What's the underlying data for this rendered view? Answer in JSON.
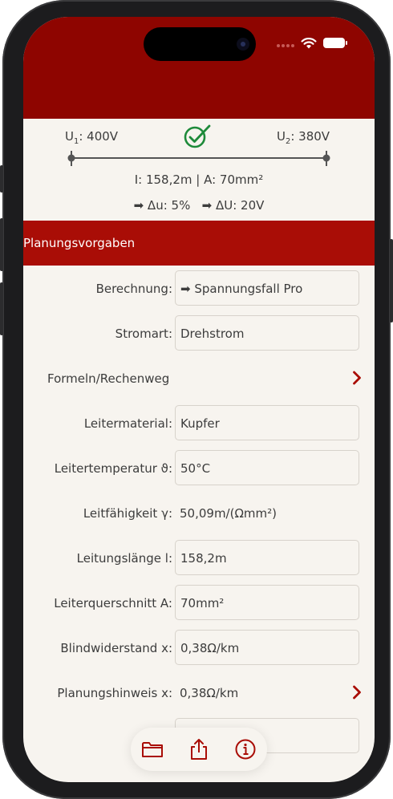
{
  "status_bar": {
    "icons": [
      "signal-dots-icon",
      "wifi-icon",
      "battery-icon"
    ]
  },
  "summary": {
    "u1_label": "U",
    "u1_sub": "1",
    "u1_value": ": 400V",
    "u2_label": "U",
    "u2_sub": "2",
    "u2_value": ": 380V",
    "status_icon": "check-circle-icon",
    "cable_line": "I: 158,2m  |  A: 70mm²",
    "drop_line_1": "➡ Δu: 5%",
    "drop_line_2": "➡ ΔU: 20V"
  },
  "section": {
    "title": "Planungsvorgaben"
  },
  "rows": [
    {
      "label": "Berechnung:",
      "value": "➡ Spannungsfall Pro"
    },
    {
      "label": "Stromart:",
      "value": "Drehstrom"
    },
    {
      "label": "Formeln/Rechenweg"
    },
    {
      "label": "Leitermaterial:",
      "value": "Kupfer"
    },
    {
      "label": "Leitertemperatur  ϑ:",
      "value": "50°C"
    },
    {
      "label": "Leitfähigkeit γ:",
      "value": "50,09m/(Ωmm²)"
    },
    {
      "label": "Leitungslänge l:",
      "value": "158,2m"
    },
    {
      "label": "Leiterquerschnitt A:",
      "value": "70mm²"
    },
    {
      "label": "Blindwiderstand x:",
      "value": "0,38Ω/km"
    },
    {
      "label": "Planungshinweis x:",
      "value": "0,38Ω/km"
    }
  ],
  "toolbar": {
    "icons": [
      "folder-icon",
      "share-icon",
      "info-icon"
    ]
  },
  "colors": {
    "header": "#8e0500",
    "section": "#a90d06",
    "accent": "#a90d06",
    "check": "#1e8a3a",
    "background": "#f7f4ef"
  }
}
